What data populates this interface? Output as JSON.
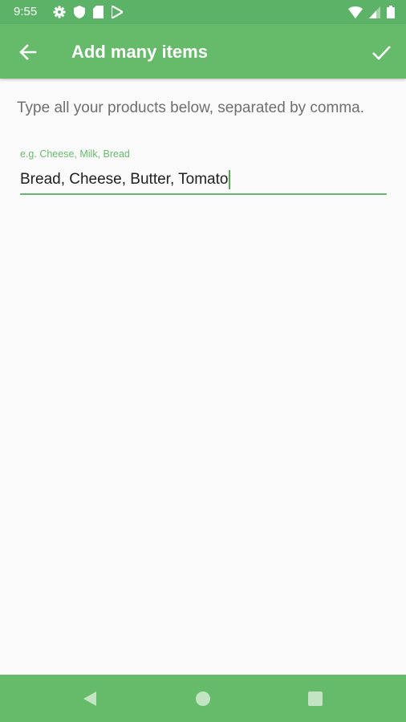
{
  "status_bar": {
    "time": "9:55",
    "left_icons": [
      "gear-icon",
      "shield-icon",
      "sd-card-icon",
      "play-store-icon"
    ],
    "right_icons": [
      "wifi-icon",
      "signal-icon",
      "battery-icon"
    ]
  },
  "app_bar": {
    "title": "Add many items",
    "back_icon": "arrow-back-icon",
    "confirm_icon": "check-icon"
  },
  "content": {
    "instructions": "Type all your products below, separated by comma.",
    "input": {
      "label": "e.g. Cheese, Milk, Bread",
      "value": "Bread, Cheese, Butter, Tomato"
    }
  },
  "nav_bar": {
    "icons": [
      "back-triangle-icon",
      "home-circle-icon",
      "recents-square-icon"
    ]
  },
  "colors": {
    "primary": "#66bb6a",
    "status_bar": "#5cb266",
    "accent": "#4caf50",
    "background": "#fafafa"
  }
}
